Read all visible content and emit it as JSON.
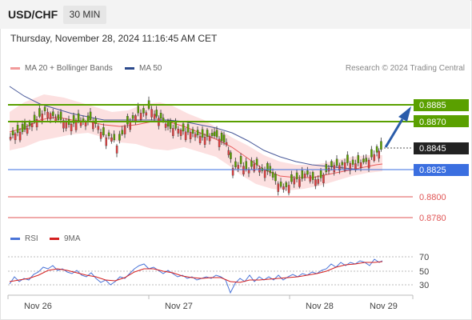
{
  "header": {
    "symbol": "USD/CHF",
    "timeframe": "30 MIN"
  },
  "datetime": "Thursday, November 28, 2024 11:16:45 AM CET",
  "legend": {
    "ma20": "MA 20 + Bollinger Bands",
    "ma50": "MA 50",
    "copyright": "Research © 2024 Trading Central",
    "rsi": "RSI",
    "rsi_ma": "9MA"
  },
  "colors": {
    "resistance": "#5aa000",
    "pivot": "#3b6fe0",
    "support": "#e05555",
    "current": "#222222",
    "arrow": "#2a5caa",
    "bull_candle": "#5aa000",
    "bear_candle": "#e04040",
    "ma20": "#e85a5a",
    "ma50": "#4a5a9a",
    "bollinger_fill": "#fbd6d6",
    "rsi_line": "#4a74d8",
    "rsi_ma_line": "#d42020"
  },
  "levels": [
    {
      "type": "resistance",
      "label": "0.8885"
    },
    {
      "type": "resistance",
      "label": "0.8870"
    },
    {
      "type": "current",
      "label": "0.8845"
    },
    {
      "type": "pivot",
      "label": "0.8825"
    },
    {
      "type": "support",
      "label": "0.8800"
    },
    {
      "type": "support",
      "label": "0.8780"
    }
  ],
  "rsi_axis": [
    "70",
    "50",
    "30"
  ],
  "x_axis": [
    "Nov 26",
    "Nov 27",
    "Nov 28",
    "Nov 29"
  ]
}
